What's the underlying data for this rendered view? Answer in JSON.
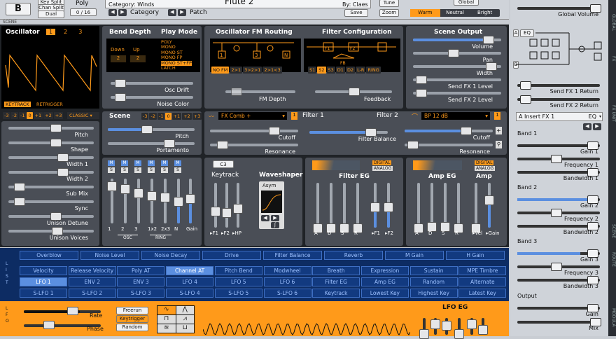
{
  "top": {
    "scene": "B",
    "poly_label": "Poly",
    "voices": "0 / 16",
    "key_split": "Key Split",
    "chan_split": "Chan Split",
    "dual": "Dual",
    "category_line": "Category: Winds",
    "category_label": "Category",
    "patch_label": "Patch",
    "patch_name": "Flute 2",
    "by": "By: Claes",
    "save": "Save",
    "tune": "Tune",
    "zoom": "Zoom",
    "global": "Global",
    "warm": "Warm",
    "neutral": "Neutral",
    "bright": "Bright"
  },
  "scene_label": "SCENE",
  "osc": {
    "title": "Oscillator",
    "nums": [
      "1",
      "2",
      "3"
    ],
    "keytrack": "KEYTRACK",
    "retrigger": "RETRIGGER",
    "octaves": [
      "-3",
      "-2",
      "-1",
      "0",
      "+1",
      "+2",
      "+3"
    ],
    "type": "CLASSIC",
    "params": [
      "Pitch",
      "Shape",
      "Width 1",
      "Width 2",
      "Sub Mix",
      "Sync",
      "Unison Detune",
      "Unison Voices"
    ]
  },
  "bend": {
    "title": "Bend Depth",
    "down": "Down",
    "up": "Up",
    "down_v": "2",
    "up_v": "2"
  },
  "playmode": {
    "title": "Play Mode",
    "modes": [
      "POLY",
      "MONO",
      "MONO ST",
      "MONO FP",
      "MONO ST+FP",
      "LATCH"
    ]
  },
  "osc_drift": "Osc Drift",
  "noise_color": "Noise Color",
  "fm": {
    "title": "Oscillator FM Routing",
    "modes": [
      "NO FM",
      "2>1",
      "3>2>1",
      "2>1<3"
    ],
    "depth": "FM Depth"
  },
  "filtcfg": {
    "title": "Filter Configuration",
    "modes": [
      "S1",
      "S2",
      "S3",
      "D1",
      "D2",
      "L-R",
      "RING"
    ],
    "feedback": "Feedback",
    "fb": "FB"
  },
  "sceneout": {
    "title": "Scene Output",
    "params": [
      "Volume",
      "Pan",
      "Width",
      "Send FX 1 Level",
      "Send FX 2 Level"
    ]
  },
  "scene": {
    "title": "Scene",
    "octaves": [
      "-3",
      "-2",
      "-1",
      "0",
      "+1",
      "+2",
      "+3"
    ],
    "pitch": "Pitch",
    "portamento": "Portamento"
  },
  "mixer": {
    "labels": [
      "1",
      "2",
      "3",
      "1x2",
      "2x3",
      "N",
      "Gain"
    ],
    "osc": "OSC",
    "ring": "RING"
  },
  "filter1": {
    "type": "FX Comb +",
    "label": "Filter 1",
    "cutoff": "Cutoff",
    "resonance": "Resonance",
    "balance": "Filter Balance"
  },
  "filter2": {
    "label": "Filter 2",
    "type": "BP 12 dB",
    "cutoff": "Cutoff",
    "resonance": "Resonance"
  },
  "keytrack": {
    "note": "C3",
    "title": "Keytrack",
    "labels": [
      "F1",
      "F2",
      "HP"
    ]
  },
  "waveshaper": {
    "title": "Waveshaper",
    "type": "Asym"
  },
  "filt_eg": {
    "title": "Filter EG",
    "digital": "DIGITAL",
    "analog": "ANALOG",
    "labels": [
      "A",
      "D",
      "S",
      "R",
      "F1",
      "F2"
    ]
  },
  "amp_eg": {
    "title": "Amp EG",
    "amp": "Amp",
    "digital": "DIGITAL",
    "analog": "ANALOG",
    "labels": [
      "A",
      "D",
      "S",
      "R",
      "Vel",
      "Gain"
    ]
  },
  "mod": {
    "row1": [
      "Overblow",
      "Noise Level",
      "Noise Decay",
      "Drive",
      "Filter Balance",
      "Reverb",
      "M Gain",
      "H Gain"
    ],
    "row2": [
      "Velocity",
      "Release Velocity",
      "Poly AT",
      "Channel AT",
      "Pitch Bend",
      "Modwheel",
      "Breath",
      "Expression",
      "Sustain",
      "MPE Timbre"
    ],
    "row3": [
      "LFO 1",
      "ENV 2",
      "ENV 3",
      "LFO 4",
      "LFO 5",
      "LFO 6",
      "Filter EG",
      "Amp EG",
      "Random",
      "Alternate"
    ],
    "row4": [
      "S-LFO 1",
      "S-LFO 2",
      "S-LFO 3",
      "S-LFO 4",
      "S-LFO 5",
      "S-LFO 6",
      "Keytrack",
      "Lowest Key",
      "Highest Key",
      "Latest Key"
    ]
  },
  "lfo": {
    "rate": "Rate",
    "phase": "Phase",
    "freerun": "Freerun",
    "keytrigger": "Keytrigger",
    "random": "Random",
    "eg": "LFO EG"
  },
  "right": {
    "global_volume": "Global Volume",
    "eq": "EQ",
    "send1": "Send FX 1 Return",
    "send2": "Send FX 2 Return",
    "insert": "A Insert FX 1",
    "eq2": "EQ",
    "bands": [
      {
        "title": "Band 1",
        "params": [
          "Gain 1",
          "Frequency 1",
          "Bandwidth 1"
        ]
      },
      {
        "title": "Band 2",
        "params": [
          "Gain 2",
          "Frequency 2",
          "Bandwidth 2"
        ]
      },
      {
        "title": "Band 3",
        "params": [
          "Gain 3",
          "Frequency 3",
          "Bandwidth 3"
        ]
      }
    ],
    "output": "Output",
    "gain": "Gain",
    "mix": "Mix"
  },
  "tabs": [
    "GLOBAL",
    "FX",
    "FX UNIT",
    "ROUTE",
    "SCENE",
    "MODULA"
  ]
}
